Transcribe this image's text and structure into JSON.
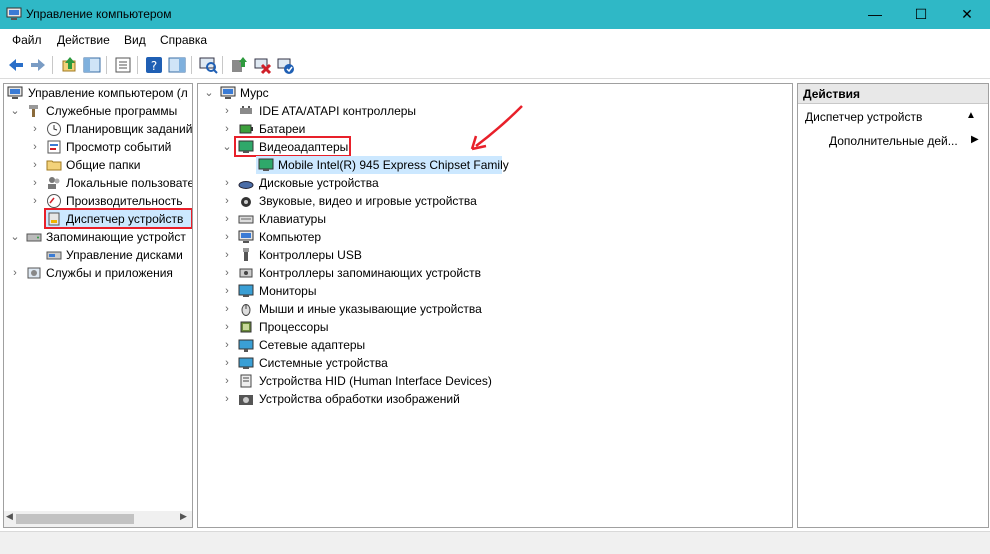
{
  "window": {
    "title": "Управление компьютером",
    "minimize": "—",
    "maximize": "☐",
    "close": "✕"
  },
  "menu": [
    "Файл",
    "Действие",
    "Вид",
    "Справка"
  ],
  "left_tree": {
    "root": "Управление компьютером (л",
    "utilities": "Служебные программы",
    "task_scheduler": "Планировщик заданий",
    "event_viewer": "Просмотр событий",
    "shared_folders": "Общие папки",
    "local_users": "Локальные пользовате",
    "performance": "Производительность",
    "device_manager": "Диспетчер устройств",
    "storage": "Запоминающие устройст",
    "disk_management": "Управление дисками",
    "services_apps": "Службы и приложения"
  },
  "device_tree": {
    "computer": "Мурс",
    "categories": [
      "IDE ATA/ATAPI контроллеры",
      "Батареи",
      "Видеоадаптеры",
      "Дисковые устройства",
      "Звуковые, видео и игровые устройства",
      "Клавиатуры",
      "Компьютер",
      "Контроллеры USB",
      "Контроллеры запоминающих устройств",
      "Мониторы",
      "Мыши и иные указывающие устройства",
      "Процессоры",
      "Сетевые адаптеры",
      "Системные устройства",
      "Устройства HID (Human Interface Devices)",
      "Устройства обработки изображений"
    ],
    "video_child": "Mobile Intel(R) 945 Express Chipset Family"
  },
  "actions": {
    "header": "Действия",
    "section": "Диспетчер устройств",
    "more": "Дополнительные дей..."
  },
  "colors": {
    "titlebar": "#2fb8c6",
    "highlight": "#e8202a",
    "selection": "#cce8ff"
  }
}
